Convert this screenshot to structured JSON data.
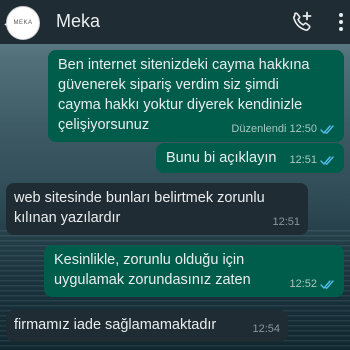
{
  "header": {
    "contact_name": "Meka",
    "avatar_text": "MEKA",
    "back_icon": "arrow-left-icon",
    "call_icon": "add-call-icon",
    "menu_icon": "more-vertical-icon"
  },
  "messages": [
    {
      "direction": "outgoing",
      "text": "Ben internet sitenizdeki cayma hakkına\ngüvenerek sipariş verdim siz şimdi\ncayma hakkı yoktur diyerek kendinizle\nçelişiyorsunuz",
      "edited_label": "Düzenlendi",
      "time": "12:50",
      "status": "read"
    },
    {
      "direction": "outgoing",
      "text": "Bunu bi açıklayın",
      "time": "12:51",
      "status": "read"
    },
    {
      "direction": "incoming",
      "text": "web sitesinde bunları belirtmek zorunlu\nkılınan yazılardır",
      "time": "12:51"
    },
    {
      "direction": "outgoing",
      "text": "Kesinlikle, zorunlu olduğu için\nuygulamak zorundasınız zaten",
      "time": "12:52",
      "status": "read"
    },
    {
      "direction": "incoming",
      "text": "firmamız iade sağlamamaktadır",
      "time": "12:54"
    }
  ],
  "colors": {
    "header_bg": "#1f2c33",
    "outgoing_bubble": "#005c4b",
    "incoming_bubble": "#202c33",
    "read_ticks": "#53bdeb"
  }
}
